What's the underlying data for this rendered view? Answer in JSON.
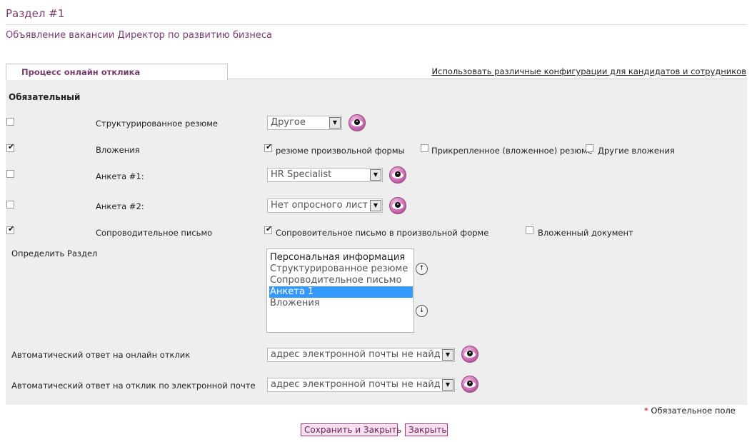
{
  "page": {
    "section_title": "Раздел #1",
    "subtitle": "Объявление вакансии Директор по развитию бизнеса"
  },
  "tab": {
    "label": "Процесс онлайн отклика",
    "config_link": "Использовать различные конфигурации для кандидатов и сотрудников"
  },
  "required_header": "Обязательный",
  "rows": {
    "structured_resume": {
      "label": "Структурированное резюме",
      "checked": false,
      "select_value": "Другое"
    },
    "attachments": {
      "label": "Вложения",
      "checked": true,
      "options": [
        {
          "label": "резюме произвольной формы",
          "checked": true
        },
        {
          "label": "Прикрепленное (вложенное) резюме",
          "checked": false
        },
        {
          "label": "Другие вложения",
          "checked": false
        }
      ]
    },
    "questionnaire1": {
      "label": "Анкета #1:",
      "checked": false,
      "select_value": "HR Specialist"
    },
    "questionnaire2": {
      "label": "Анкета #2:",
      "checked": false,
      "select_value": "Нет опросного листа"
    },
    "cover_letter": {
      "label": "Сопроводительное письмо",
      "checked": true,
      "options": [
        {
          "label": "Сопровоительное письмо в произвольной форме",
          "checked": true
        },
        {
          "label": "Вложенный документ",
          "checked": false
        }
      ]
    }
  },
  "define_section": {
    "label": "Определить Раздел",
    "items": [
      "Персональная информация",
      "Структурированное резюме",
      "Сопроводительное письмо",
      "Анкета 1",
      "Вложения"
    ],
    "selected": "Анкета 1"
  },
  "auto_reply_online": {
    "label": "Автоматический ответ на онлайн отклик",
    "select_value": "адрес электронной почты не найден"
  },
  "auto_reply_email": {
    "label": "Автоматический ответ на отклик по электронной почте",
    "select_value": "адрес электронной почты не найден"
  },
  "required_note": {
    "star": "*",
    "text": "Обязательное поле"
  },
  "buttons": {
    "save_close": "Сохранить и Закрыть",
    "close": "Закрыть"
  },
  "icons": {
    "eye": "eye-icon",
    "checkmark": "✔",
    "dropdown_arrow": "▼",
    "move_up": "↑",
    "move_down": "↓"
  },
  "colors": {
    "accent": "#7a3b6e",
    "panel_bg": "#eeeeee",
    "selection": "#3399ff",
    "button_border": "#a23a82",
    "required_star": "#cc0000"
  }
}
